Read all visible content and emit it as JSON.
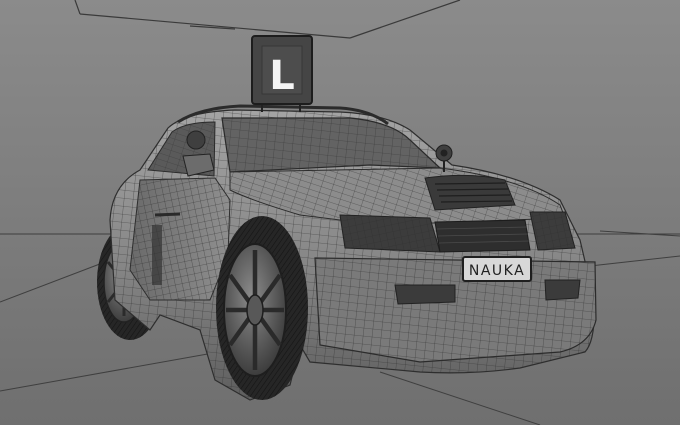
{
  "scene": {
    "sign_letter": "L",
    "plate_text": "NAUKA"
  },
  "colors": {
    "background_top": "#8a8a8a",
    "background_bottom": "#6e6e6e",
    "body_light": "#9a9a9a",
    "body_mid": "#7d7d7d",
    "body_dark": "#4f4f4f",
    "wire": "#2e2e2e",
    "tire": "#2a2a2a",
    "plate": "#d9d9d9",
    "sign_bg": "#454545"
  }
}
